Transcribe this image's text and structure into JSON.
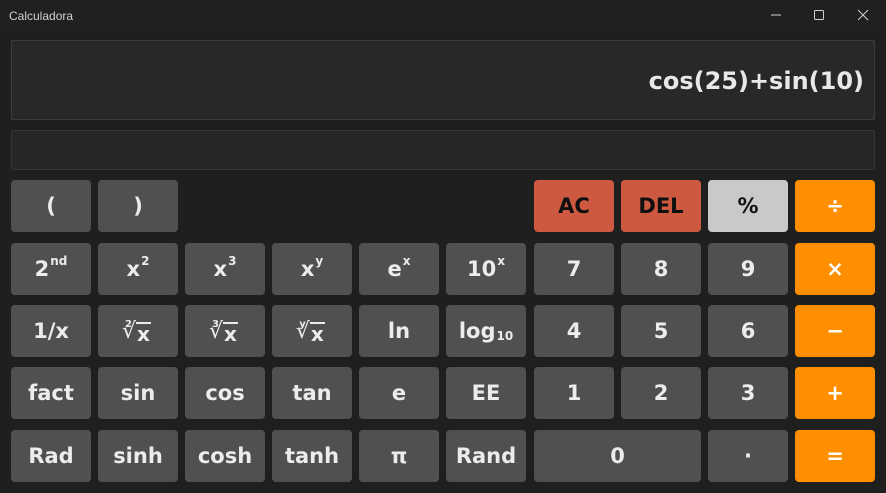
{
  "window": {
    "title": "Calculadora"
  },
  "display": {
    "expression": "cos(25)+sin(10)",
    "result": ""
  },
  "keys": {
    "lparen": "(",
    "rparen": ")",
    "ac": "AC",
    "del": "DEL",
    "percent": "%",
    "divide": "÷",
    "second": "2",
    "second_sup": "nd",
    "xsq": "x",
    "xsq_sup": "2",
    "xcube": "x",
    "xcube_sup": "3",
    "xpowy": "x",
    "xpowy_sup": "y",
    "exp": "e",
    "exp_sup": "x",
    "ten": "10",
    "ten_sup": "x",
    "seven": "7",
    "eight": "8",
    "nine": "9",
    "multiply": "×",
    "recip": "1/x",
    "sqrt_idx": "2",
    "sqrt_x": "x",
    "cbrt_idx": "3",
    "cbrt_x": "x",
    "yroot_idx": "y",
    "yroot_x": "x",
    "ln": "ln",
    "log": "log",
    "log_sub": "10",
    "four": "4",
    "five": "5",
    "six": "6",
    "minus": "−",
    "fact": "fact",
    "sin": "sin",
    "cos": "cos",
    "tan": "tan",
    "e": "e",
    "ee": "EE",
    "one": "1",
    "two": "2",
    "three": "3",
    "plus": "+",
    "rad": "Rad",
    "sinh": "sinh",
    "cosh": "cosh",
    "tanh": "tanh",
    "pi": "π",
    "rand": "Rand",
    "zero": "0",
    "dot": "·",
    "equals": "="
  },
  "colors": {
    "accent": "#ff8f00",
    "danger": "#cc5940",
    "key": "#505050",
    "light_key": "#c9c9c9"
  },
  "icons": {
    "minimize": "minimize-icon",
    "maximize": "maximize-icon",
    "close": "close-icon"
  }
}
